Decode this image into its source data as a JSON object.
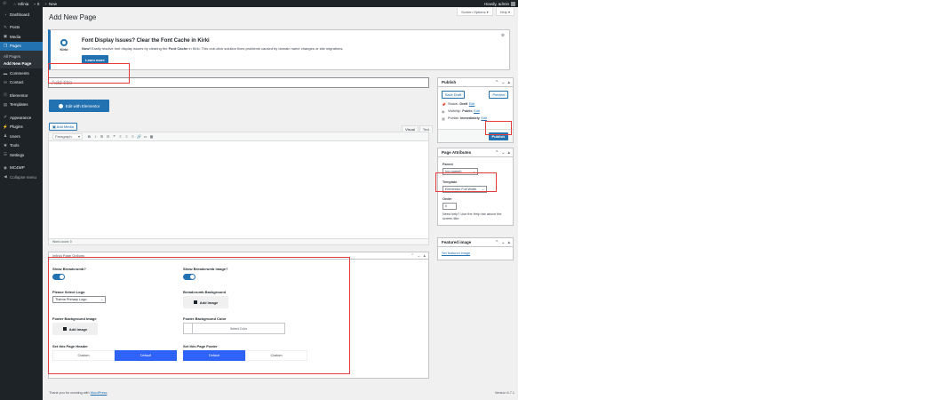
{
  "admin_bar": {
    "site_name": "Infinia",
    "comments_count": "0",
    "new_label": "New",
    "greeting": "Howdy, admin"
  },
  "sidebar": {
    "items": [
      {
        "label": "Dashboard",
        "icon": "dashboard-icon"
      },
      {
        "label": "Posts",
        "icon": "pin-icon"
      },
      {
        "label": "Media",
        "icon": "media-icon"
      },
      {
        "label": "Pages",
        "icon": "pages-icon"
      },
      {
        "label": "Comments",
        "icon": "comments-icon"
      },
      {
        "label": "Contact",
        "icon": "envelope-icon"
      },
      {
        "label": "Elementor",
        "icon": "elementor-icon"
      },
      {
        "label": "Templates",
        "icon": "folder-icon"
      },
      {
        "label": "Appearance",
        "icon": "brush-icon"
      },
      {
        "label": "Plugins",
        "icon": "plug-icon"
      },
      {
        "label": "Users",
        "icon": "user-icon"
      },
      {
        "label": "Tools",
        "icon": "wrench-icon"
      },
      {
        "label": "Settings",
        "icon": "sliders-icon"
      },
      {
        "label": "MC4WP",
        "icon": "mc4wp-icon"
      },
      {
        "label": "Collapse menu",
        "icon": "collapse-icon"
      }
    ],
    "submenu": [
      "All Pages",
      "Add New Page"
    ]
  },
  "header": {
    "title": "Add New Page",
    "screen_options": "Screen Options ▾",
    "help": "Help ▾"
  },
  "notice": {
    "logo_text": "Kirki",
    "title": "Font Display Issues? Clear the Font Cache in Kirki",
    "desc_pre": "Now!",
    "desc_mid": " Easily resolve font display issues by clearing the ",
    "desc_bold": "Font Cache",
    "desc_post": " in Kirki. This one-click solution fixes problems caused by domain name changes or site migrations.",
    "button": "Learn more"
  },
  "editor": {
    "title_placeholder": "Add title",
    "elementor_button": "Edit with Elementor",
    "add_media": "Add Media",
    "tab_visual": "Visual",
    "tab_text": "Text",
    "format_select": "Paragraph",
    "word_count": "Word count: 0"
  },
  "publish": {
    "heading": "Publish",
    "save_draft": "Save Draft",
    "preview": "Preview",
    "status_label": "Status:",
    "status_value": "Draft",
    "visibility_label": "Visibility:",
    "visibility_value": "Public",
    "publish_label": "Publish",
    "publish_value": "immediately",
    "edit": "Edit",
    "publish_button": "Publish"
  },
  "page_attributes": {
    "heading": "Page Attributes",
    "parent_label": "Parent",
    "parent_value": "(no parent)",
    "template_label": "Template",
    "template_value": "Elementor Full Width",
    "order_label": "Order",
    "order_value": "0",
    "help_text": "Need help? Use the Help tab above the screen title."
  },
  "featured_image": {
    "heading": "Featured image",
    "link": "Set featured image"
  },
  "infinia_options": {
    "heading": "Infinia Page Options",
    "show_breadcrumb": "Show Breadcrumb?",
    "show_breadcrumb_image": "Show Breadcrumb image?",
    "select_logo": "Please Select Logo",
    "logo_value": "Theme Primary Logo",
    "breadcrumb_bg": "Breadcrumb Background",
    "add_image": "Add Image",
    "footer_bg_image": "Footer Background Image",
    "footer_bg_color": "Footer Background Color",
    "select_color": "Select Color",
    "set_header": "Set this Page Header",
    "set_footer": "Set this Page Footer",
    "custom": "Custom",
    "default": "Default",
    "show_breadcrumb_on": true,
    "show_breadcrumb_image_on": true
  },
  "footer": {
    "thanks_pre": "Thank you for creating with ",
    "thanks_link": "WordPress",
    "thanks_post": ".",
    "version": "Version 6.7.1"
  },
  "colors": {
    "admin_dark": "#1d2327",
    "accent_blue": "#2271b1",
    "segment_blue": "#2f62f6",
    "highlight_red": "#e63b3b"
  }
}
